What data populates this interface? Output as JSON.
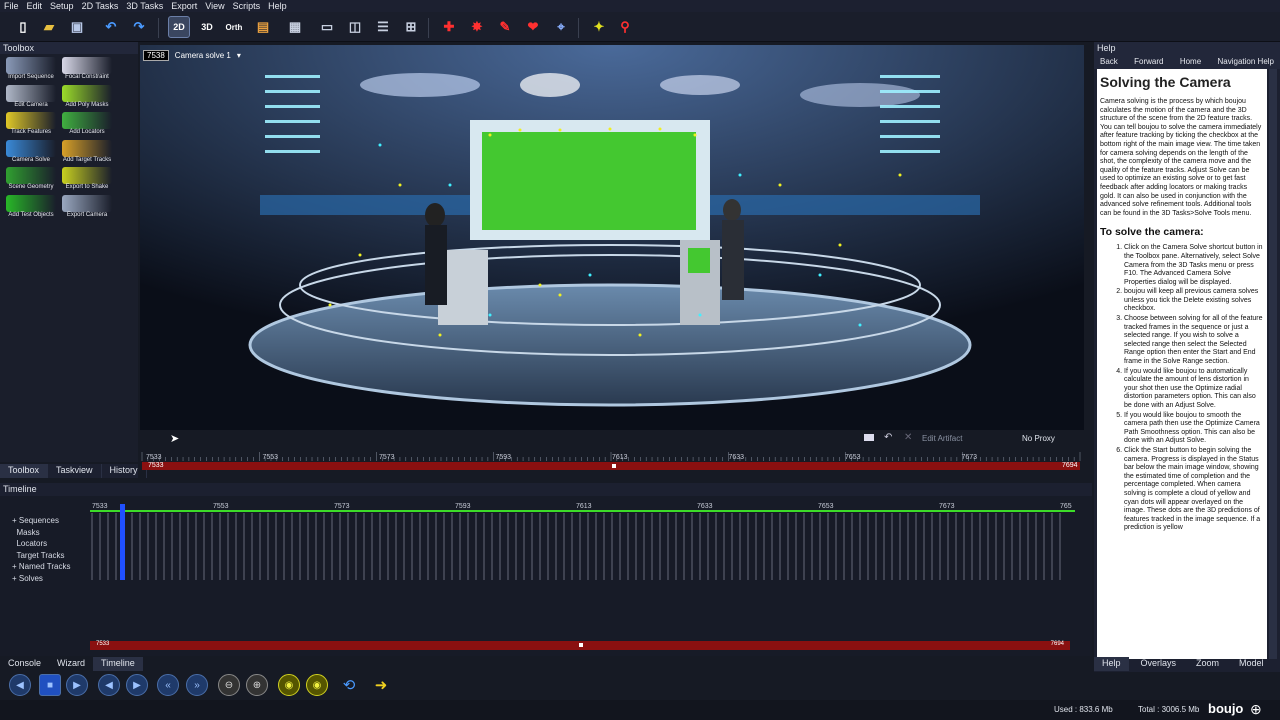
{
  "menu": [
    "File",
    "Edit",
    "Setup",
    "2D Tasks",
    "3D Tasks",
    "Export",
    "View",
    "Scripts",
    "Help"
  ],
  "toolbar": {
    "selected_view": "2D",
    "icons": [
      "new-icon",
      "open-icon",
      "save-icon",
      "undo-icon",
      "redo-icon",
      "view-2d-icon",
      "view-3d-icon",
      "view-orth-icon",
      "image-view-icon",
      "grid-icon",
      "split-view-1-icon",
      "split-view-2-icon",
      "split-view-3-icon",
      "split-view-4-icon",
      "tool-1-icon",
      "tool-2-icon",
      "tool-3-icon",
      "tool-4-icon",
      "tool-5-icon",
      "tool-6-icon",
      "tool-7-icon"
    ],
    "labels": {
      "v2d": "2D",
      "v3d": "3D",
      "orth": "Orth"
    }
  },
  "toolbox": {
    "title": "Toolbox",
    "tools": [
      {
        "label": "Import Sequence",
        "color": "#8a9ab8"
      },
      {
        "label": "Focal Constraint",
        "color": "#d8d8e8"
      },
      {
        "label": "Edit Camera",
        "color": "#b0b8c8"
      },
      {
        "label": "Add Poly Masks",
        "color": "#9bdc2a"
      },
      {
        "label": "Track Features",
        "color": "#e0c828"
      },
      {
        "label": "Add Locators",
        "color": "#40b040"
      },
      {
        "label": "Camera Solve",
        "color": "#3a8ad8"
      },
      {
        "label": "Add Target Tracks",
        "color": "#d8a028"
      },
      {
        "label": "Scene Geometry",
        "color": "#30a030"
      },
      {
        "label": "Export to Shake",
        "color": "#c8d020"
      },
      {
        "label": "Add Test Objects",
        "color": "#28b828"
      },
      {
        "label": "Export Camera",
        "color": "#9aa8c0"
      }
    ]
  },
  "left_tabs": [
    "Toolbox",
    "Taskview",
    "History"
  ],
  "viewport": {
    "frame": "7538",
    "camera": "Camera solve 1",
    "edit_artifact": "Edit Artifact",
    "proxy": "No Proxy"
  },
  "ruler": {
    "ticks": [
      "7533",
      "7553",
      "7573",
      "7593",
      "7613",
      "7633",
      "7653",
      "7673",
      "7694"
    ],
    "start": "7533",
    "end": "7694"
  },
  "timeline": {
    "title": "Timeline",
    "tree": [
      "Sequences",
      "Masks",
      "Locators",
      "Target Tracks",
      "Named Tracks",
      "Solves"
    ],
    "ticks": [
      "7533",
      "7553",
      "7573",
      "7593",
      "7613",
      "7633",
      "7653",
      "7673",
      "765"
    ],
    "range_start": "7533",
    "range_end": "7694"
  },
  "bottom_tabs": [
    "Console",
    "Wizard",
    "Timeline"
  ],
  "status": {
    "used": "Used : 833.6 Mb",
    "total": "Total : 3006.5 Mb",
    "brand": "boujo"
  },
  "help": {
    "panel_title": "Help",
    "nav": [
      "Back",
      "Forward",
      "Home",
      "Navigation Help"
    ],
    "title": "Solving the Camera",
    "intro": "Camera solving is the process by which boujou calculates the motion of the camera and the 3D structure of the scene from the 2D feature tracks. You can tell boujou to solve the camera immediately after feature tracking by ticking the checkbox at the bottom right of the main image view. The time taken for camera solving depends on the length of the shot, the complexity of the camera move and the quality of the feature tracks. Adjust Solve can be used to optimize an existing solve or to get fast feedback after adding locators or making tracks gold. It can also be used in conjunction with the advanced solve refinement tools. Additional tools can be found in the 3D Tasks>Solve Tools menu.",
    "subtitle": "To solve the camera:",
    "steps": [
      "Click on the Camera Solve shortcut button in the Toolbox pane. Alternatively, select Solve Camera from the 3D Tasks menu or press F10. The Advanced Camera Solve Properties dialog will be displayed.",
      "boujou will keep all previous camera solves unless you tick the Delete existing solves checkbox.",
      "Choose between solving for all of the feature tracked frames in the sequence or just a selected range. If you wish to solve a selected range then select the Selected Range option then enter the Start and End frame in the Solve Range section.",
      "If you would like boujou to automatically calculate the amount of lens distortion in your shot then use the Optimize radial distortion parameters option. This can also be done with an Adjust Solve.",
      "If you would like boujou to smooth the camera path then use the Optimize Camera Path Smoothness option. This can also be done with an Adjust Solve.",
      "Click the Start button to begin solving the camera. Progress is displayed in the Status bar below the main image window, showing the estimated time of completion and the percentage completed. When camera solving is complete a cloud of yellow and cyan dots will appear overlayed on the image. These dots are the 3D predictions of features tracked in the image sequence. If a prediction is yellow"
    ],
    "tabs": [
      "Help",
      "Overlays",
      "Zoom",
      "Model"
    ]
  },
  "colors": {
    "accent": "#3a8ad8",
    "range_bar": "#a01818",
    "track_green": "#3cdc28",
    "playhead": "#2050ff"
  }
}
